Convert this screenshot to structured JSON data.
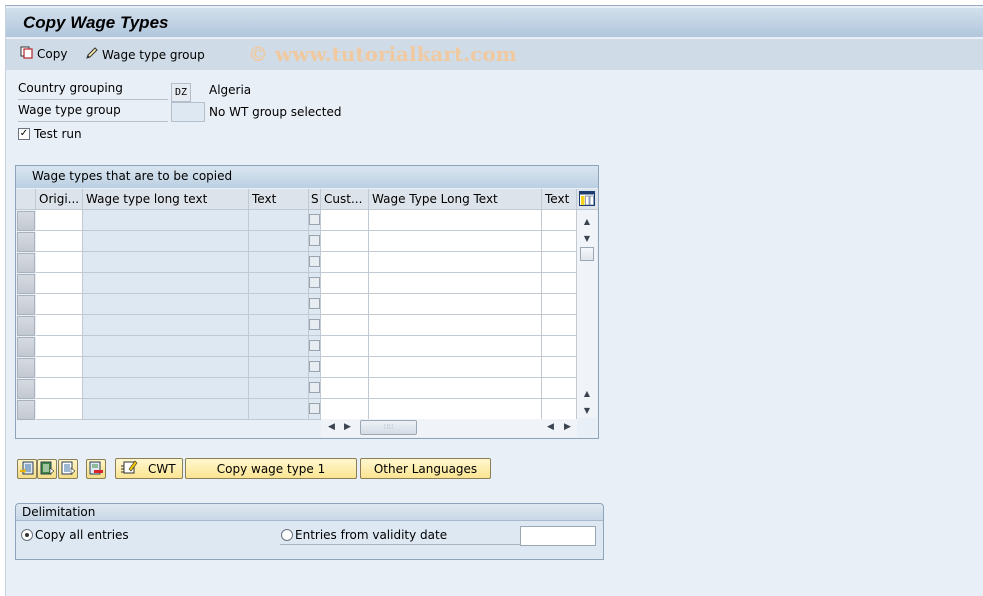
{
  "window": {
    "title": "Copy Wage Types"
  },
  "toolbar": {
    "copy_label": "Copy",
    "wage_type_group_label": "Wage type group",
    "watermark": "© www.tutorialkart.com"
  },
  "selection": {
    "country_grouping_label": "Country grouping",
    "country_grouping_value": "DZ",
    "country_grouping_text": "Algeria",
    "wage_type_group_label": "Wage type group",
    "wage_type_group_value": "",
    "wage_type_group_text": "No WT group selected",
    "test_run_label": "Test run",
    "test_run_checked": true
  },
  "table": {
    "title": "Wage types that are to be copied",
    "columns": [
      {
        "label": "Origi..."
      },
      {
        "label": "Wage type long text"
      },
      {
        "label": "Text"
      },
      {
        "label": "S"
      },
      {
        "label": "Cust..."
      },
      {
        "label": "Wage Type Long Text"
      },
      {
        "label": "Text"
      }
    ],
    "row_count": 10,
    "rows": []
  },
  "actions": {
    "icon_buttons": [
      {
        "name": "insert-row-icon"
      },
      {
        "name": "select-all-icon"
      },
      {
        "name": "select-block-icon"
      },
      {
        "name": "delete-row-icon"
      }
    ],
    "cwt_label": "CWT",
    "copy_wage_type_label": "Copy wage type 1",
    "other_languages_label": "Other Languages"
  },
  "delimitation": {
    "title": "Delimitation",
    "option_all_label": "Copy all entries",
    "option_date_label": "Entries from validity date",
    "selected": "all",
    "validity_date_value": ""
  }
}
